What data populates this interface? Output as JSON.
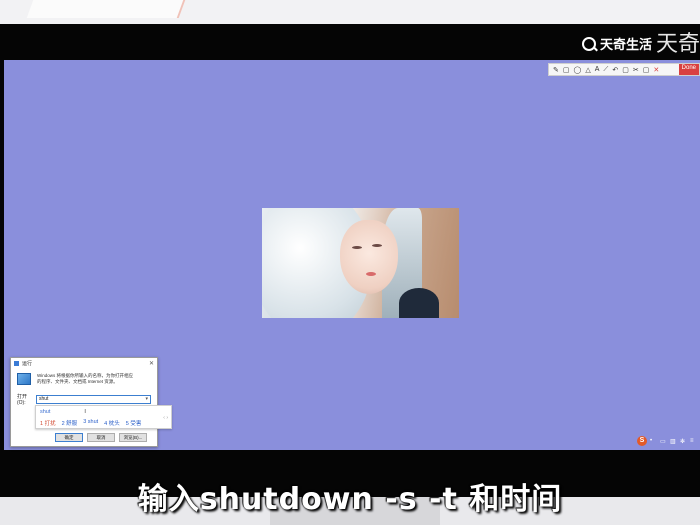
{
  "watermark": {
    "brand": "天奇生活",
    "corner_text": "天奇"
  },
  "snip_toolbar": {
    "tools": [
      "✎",
      "▢",
      "◯",
      "△",
      "A",
      "⟋",
      "↶",
      "▢",
      "✂",
      "▢"
    ],
    "action_label": "Done",
    "close_label": "✕"
  },
  "run_dialog": {
    "title": "运行",
    "description": "Windows 将根据你所输入的名称，为你打开相应的程序、文件夹、文档或 Internet 资源。",
    "open_label": "打开(O):",
    "input_value": "shut",
    "buttons": {
      "ok": "确定",
      "cancel": "取消",
      "browse": "浏览(B)..."
    }
  },
  "ime": {
    "composition": "shut",
    "candidates": [
      "1 打扰",
      "2 舒服",
      "3 shut",
      "4 枕头",
      "5 受害"
    ],
    "arrows": "‹ ›"
  },
  "tray": {
    "ime_logo": "S"
  },
  "subtitle": "输入shutdown -s -t 和时间"
}
